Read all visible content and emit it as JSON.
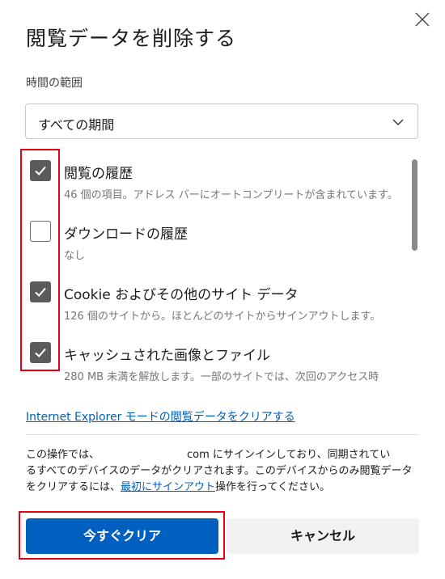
{
  "dialog": {
    "title": "閲覧データを削除する",
    "close_icon": "close-icon"
  },
  "time_range": {
    "label": "時間の範囲",
    "selected": "すべての期間"
  },
  "items": [
    {
      "title": "閲覧の履歴",
      "desc": "46 個の項目。アドレス バーにオートコンプリートが含まれています。",
      "checked": true
    },
    {
      "title": "ダウンロードの履歴",
      "desc": "なし",
      "checked": false
    },
    {
      "title": "Cookie およびその他のサイト データ",
      "desc": "126 個のサイトから。ほとんどのサイトからサインアウトします。",
      "checked": true
    },
    {
      "title": "キャッシュされた画像とファイル",
      "desc": "280 MB 未満を解放します。一部のサイトでは、次回のアクセス時",
      "checked": true
    }
  ],
  "ie_link": "Internet Explorer モードの閲覧データをクリアする",
  "info": {
    "line1_a": "この操作では、",
    "line1_b": "com にサインインしており、同期されてい",
    "line2": "るすべてのデバイスのデータがクリアされます。このデバイスからのみ閲覧データ",
    "line3_a": "をクリアするには、",
    "line3_link": "最初にサインアウト",
    "line3_b": "操作を行ってください。"
  },
  "buttons": {
    "clear_now": "今すぐクリア",
    "cancel": "キャンセル"
  },
  "colors": {
    "primary": "#0060c0",
    "link": "#0060b8",
    "highlight": "#e60012",
    "checkbox_on": "#5b5b5b"
  }
}
